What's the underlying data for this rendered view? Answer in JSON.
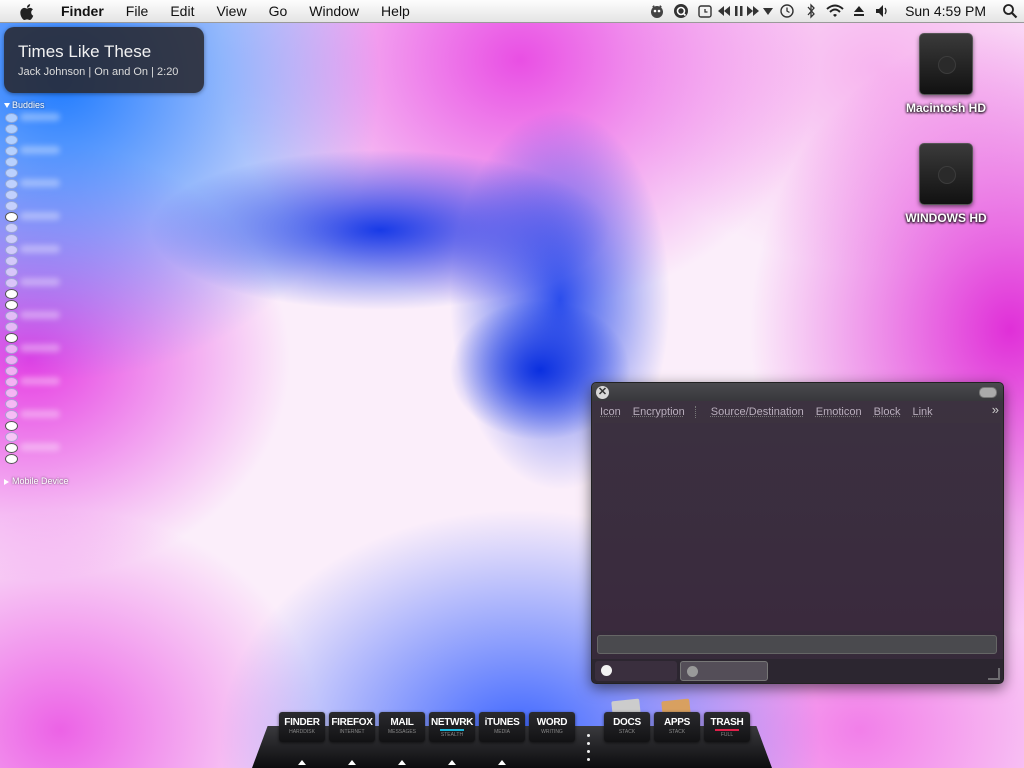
{
  "menubar": {
    "items": [
      "Finder",
      "File",
      "Edit",
      "View",
      "Go",
      "Window",
      "Help"
    ],
    "clock": "Sun 4:59 PM",
    "extras": [
      "growl-icon",
      "quicksilver-icon",
      "alarm-icon",
      "media-controls-icon",
      "time-machine-icon",
      "bluetooth-icon",
      "wifi-icon",
      "eject-icon",
      "volume-icon",
      "spotlight-icon"
    ]
  },
  "now_playing": {
    "title": "Times Like These",
    "subtitle": "Jack Johnson | On and On | 2:20"
  },
  "buddies": {
    "header": "Buddies",
    "group2": "Mobile Device"
  },
  "desktop_icons": [
    {
      "label": "Macintosh HD"
    },
    {
      "label": "WINDOWS HD"
    }
  ],
  "chat": {
    "toolbar": [
      "Icon",
      "Encryption",
      "Source/Destination",
      "Emoticon",
      "Block",
      "Link"
    ]
  },
  "dock": {
    "items": [
      {
        "label": "FINDER",
        "sub": "HARDDISK"
      },
      {
        "label": "FIREFOX",
        "sub": "INTERNET"
      },
      {
        "label": "MAIL",
        "sub": "MESSAGES"
      },
      {
        "label": "NETWRK",
        "sub": "STEALTH"
      },
      {
        "label": "iTUNES",
        "sub": "MEDIA"
      },
      {
        "label": "WORD",
        "sub": "WRITING"
      },
      {
        "label": "DOCS",
        "sub": "STACK"
      },
      {
        "label": "APPS",
        "sub": "STACK"
      },
      {
        "label": "TRASH",
        "sub": "FULL"
      }
    ]
  },
  "colors": {
    "netwrk_bar": "#1ab6d8",
    "trash_bar": "#e0204a"
  }
}
